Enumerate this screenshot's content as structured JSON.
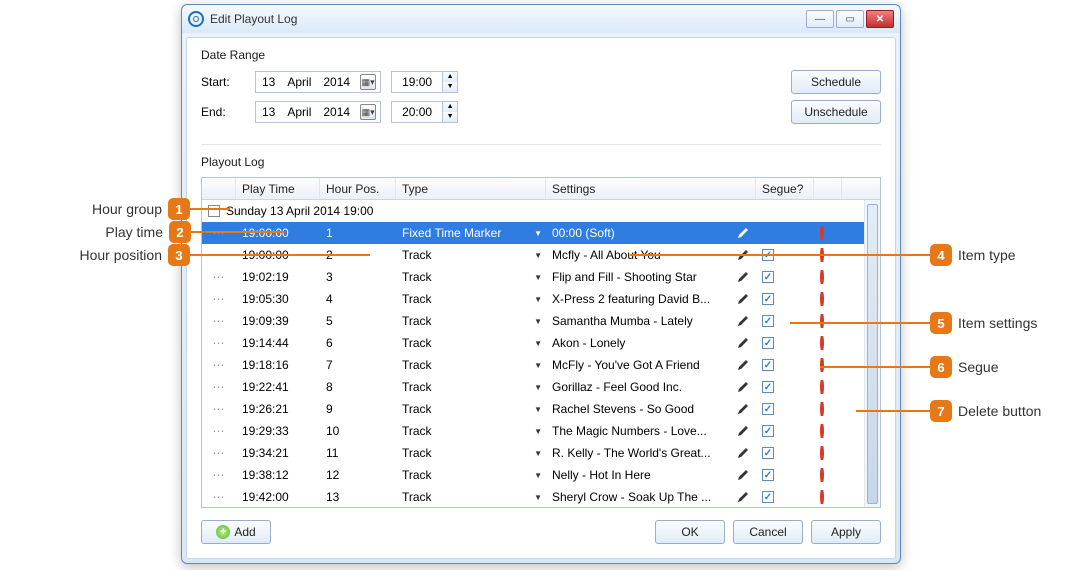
{
  "window": {
    "title": "Edit Playout Log"
  },
  "date_range": {
    "section": "Date Range",
    "start_label": "Start:",
    "end_label": "End:",
    "start": {
      "day": "13",
      "month": "April",
      "year": "2014",
      "time": "19:00"
    },
    "end": {
      "day": "13",
      "month": "April",
      "year": "2014",
      "time": "20:00"
    },
    "schedule_label": "Schedule",
    "unschedule_label": "Unschedule"
  },
  "playout": {
    "section": "Playout Log",
    "columns": {
      "play_time": "Play Time",
      "hour_pos": "Hour Pos.",
      "type": "Type",
      "settings": "Settings",
      "segue": "Segue?"
    },
    "group": "Sunday 13 April 2014 19:00",
    "rows": [
      {
        "play_time": "19:00:00",
        "hour_pos": "1",
        "type": "Fixed Time Marker",
        "settings": "00:00 (Soft)",
        "segue": false,
        "selected": true
      },
      {
        "play_time": "19:00:00",
        "hour_pos": "2",
        "type": "Track",
        "settings": "Mcfly - All About You",
        "segue": true
      },
      {
        "play_time": "19:02:19",
        "hour_pos": "3",
        "type": "Track",
        "settings": "Flip and Fill - Shooting Star",
        "segue": true
      },
      {
        "play_time": "19:05:30",
        "hour_pos": "4",
        "type": "Track",
        "settings": "X-Press 2 featuring David B...",
        "segue": true
      },
      {
        "play_time": "19:09:39",
        "hour_pos": "5",
        "type": "Track",
        "settings": "Samantha Mumba - Lately",
        "segue": true
      },
      {
        "play_time": "19:14:44",
        "hour_pos": "6",
        "type": "Track",
        "settings": "Akon - Lonely",
        "segue": true
      },
      {
        "play_time": "19:18:16",
        "hour_pos": "7",
        "type": "Track",
        "settings": "McFly - You've Got A Friend",
        "segue": true
      },
      {
        "play_time": "19:22:41",
        "hour_pos": "8",
        "type": "Track",
        "settings": "Gorillaz - Feel Good Inc.",
        "segue": true
      },
      {
        "play_time": "19:26:21",
        "hour_pos": "9",
        "type": "Track",
        "settings": "Rachel Stevens - So Good",
        "segue": true
      },
      {
        "play_time": "19:29:33",
        "hour_pos": "10",
        "type": "Track",
        "settings": "The Magic Numbers - Love...",
        "segue": true
      },
      {
        "play_time": "19:34:21",
        "hour_pos": "11",
        "type": "Track",
        "settings": "R. Kelly - The World's Great...",
        "segue": true
      },
      {
        "play_time": "19:38:12",
        "hour_pos": "12",
        "type": "Track",
        "settings": "Nelly - Hot In Here",
        "segue": true
      },
      {
        "play_time": "19:42:00",
        "hour_pos": "13",
        "type": "Track",
        "settings": "Sheryl Crow - Soak Up The ...",
        "segue": true
      }
    ]
  },
  "buttons": {
    "add": "Add",
    "ok": "OK",
    "cancel": "Cancel",
    "apply": "Apply"
  },
  "annotations": {
    "left": [
      {
        "n": "1",
        "label": "Hour group"
      },
      {
        "n": "2",
        "label": "Play time"
      },
      {
        "n": "3",
        "label": "Hour position"
      }
    ],
    "right": [
      {
        "n": "4",
        "label": "Item type"
      },
      {
        "n": "5",
        "label": "Item settings"
      },
      {
        "n": "6",
        "label": "Segue"
      },
      {
        "n": "7",
        "label": "Delete button"
      }
    ]
  }
}
